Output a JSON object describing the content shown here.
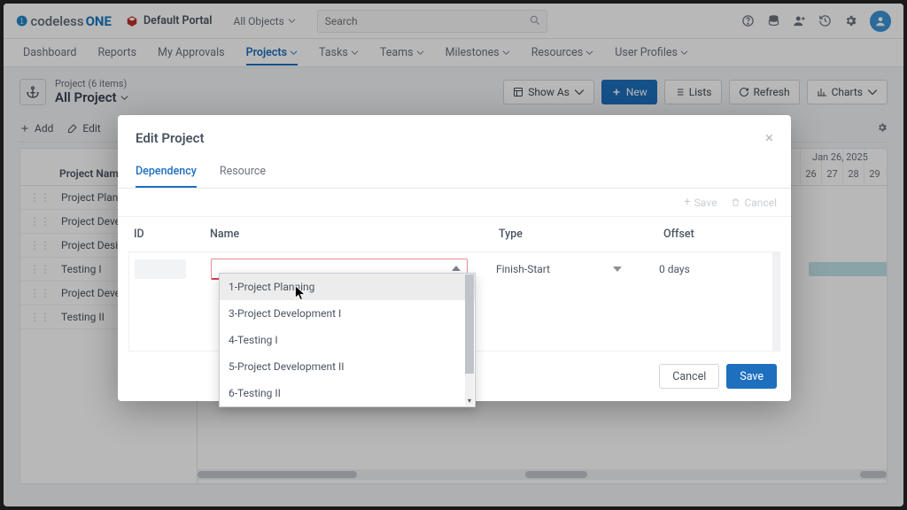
{
  "brand": {
    "o": "❶",
    "codeless": "codeless",
    "one": "ONE"
  },
  "portal": {
    "label": "Default Portal"
  },
  "objects": {
    "label": "All Objects"
  },
  "search": {
    "placeholder": "Search"
  },
  "nav": {
    "items": [
      "Dashboard",
      "Reports",
      "My Approvals",
      "Projects",
      "Tasks",
      "Teams",
      "Milestones",
      "Resources",
      "User Profiles"
    ],
    "active_index": 3,
    "has_caret": [
      false,
      false,
      false,
      true,
      true,
      true,
      true,
      true,
      true
    ]
  },
  "page_header": {
    "context": "Project (6 items)",
    "title": "All Project",
    "actions": {
      "show_as": "Show As",
      "new": "New",
      "lists": "Lists",
      "refresh": "Refresh",
      "charts": "Charts"
    }
  },
  "toolbar": {
    "add": "Add",
    "edit": "Edit"
  },
  "grid": {
    "name_header": "Project Name",
    "rows": [
      "Project Planning",
      "Project Development I",
      "Project Design",
      "Testing I",
      "Project Development II",
      "Testing II"
    ],
    "timeline_label": "Jan 26, 2025",
    "days": [
      "26",
      "27",
      "28",
      "29"
    ]
  },
  "modal": {
    "title": "Edit Project",
    "tabs": [
      "Dependency",
      "Resource"
    ],
    "active_tab": 0,
    "subbar": {
      "save": "Save",
      "cancel": "Cancel"
    },
    "columns": {
      "id": "ID",
      "name": "Name",
      "type": "Type",
      "offset": "Offset"
    },
    "row": {
      "type": "Finish-Start",
      "offset": "0 days"
    },
    "dropdown_options": [
      "1-Project Planning",
      "3-Project Development I",
      "4-Testing I",
      "5-Project Development II",
      "6-Testing II"
    ],
    "footer": {
      "cancel": "Cancel",
      "save": "Save"
    }
  }
}
